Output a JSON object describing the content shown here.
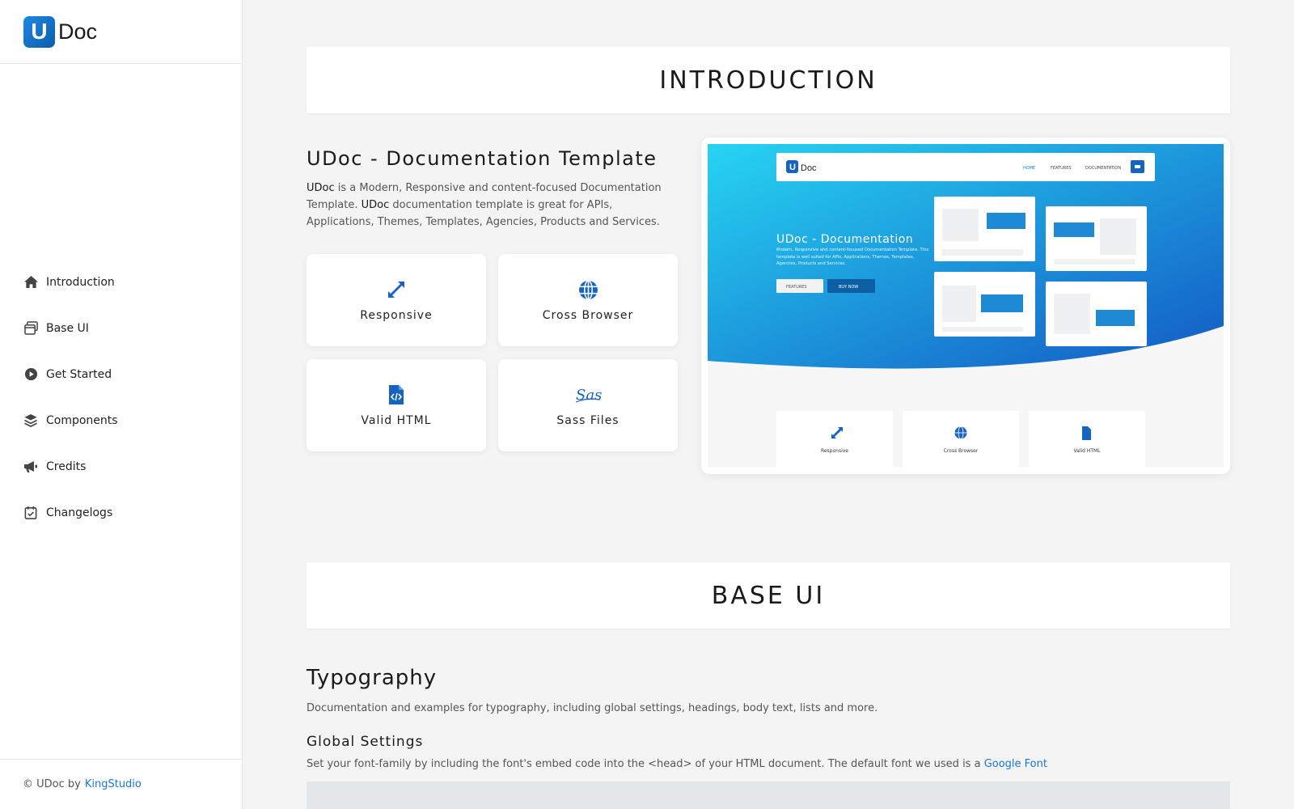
{
  "brand": {
    "letter": "U",
    "name": "Doc"
  },
  "sidebar": {
    "items": [
      {
        "label": "Introduction",
        "icon": "home-icon"
      },
      {
        "label": "Base UI",
        "icon": "window-icon"
      },
      {
        "label": "Get Started",
        "icon": "play-circle-icon"
      },
      {
        "label": "Components",
        "icon": "layers-icon"
      },
      {
        "label": "Credits",
        "icon": "megaphone-icon"
      },
      {
        "label": "Changelogs",
        "icon": "calendar-check-icon"
      }
    ],
    "footer": {
      "prefix": "© UDoc by",
      "link": "KingStudio"
    }
  },
  "intro": {
    "header": "INTRODUCTION",
    "title": "UDoc - Documentation Template",
    "desc_name1": "UDoc",
    "desc_part1": " is a  Modern,  Responsive and content-focused  Documentation Template. ",
    "desc_name2": "UDoc",
    "desc_part2": " documentation template is great for APIs, Applications, Themes, Templates, Agencies,  Products and Services.",
    "features": [
      {
        "label": "Responsive",
        "icon": "expand-arrows-icon"
      },
      {
        "label": "Cross Browser",
        "icon": "globe-icon"
      },
      {
        "label": "Valid HTML",
        "icon": "code-file-icon"
      },
      {
        "label": "Sass Files",
        "icon": "sass-icon"
      }
    ],
    "preview": {
      "brand": "Doc",
      "nav": [
        "HOME",
        "FEATURES",
        "DOCUMENTATION"
      ],
      "hero_title": "UDoc - Documentation",
      "hero_text": "Modern, Responsive and content-focused Documentation Template. This template is well suited for APIs, Applications, Themes, Templates, Agencies, Products and Services.",
      "btn_features": "FEATURES",
      "btn_buy": "BUY NOW",
      "cards": [
        "Responsive",
        "Cross Browser",
        "Valid HTML"
      ]
    }
  },
  "base_ui": {
    "header": "BASE UI",
    "typography_title": "Typography",
    "typography_desc": "Documentation and examples for typography, including global settings, headings, body text, lists and more.",
    "global_title": "Global Settings",
    "global_desc": "Set your font-family by including the font's embed code into the <head> of your  HTML document. The default font we used is a ",
    "global_link": "Google  Font"
  },
  "colors": {
    "accent": "#1976d2",
    "brand_blue": "#0b5ea8",
    "hero_start": "#26c6f0",
    "hero_end": "#1565c0"
  }
}
